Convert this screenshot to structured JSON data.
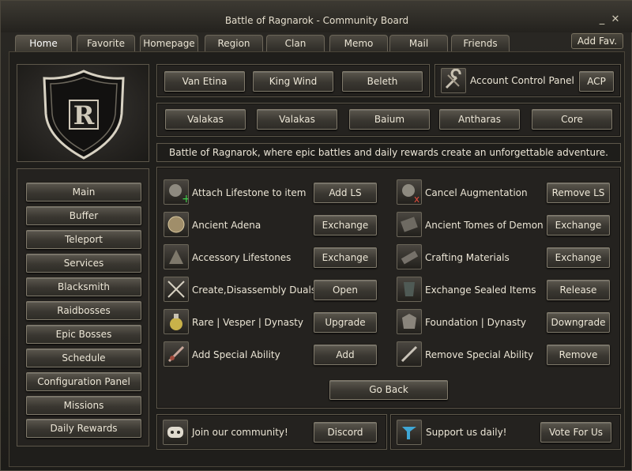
{
  "window": {
    "title": "Battle of Ragnarok - Community Board",
    "minimize": "_",
    "close": "✕"
  },
  "tabs": [
    "Home",
    "Favorite",
    "Homepage",
    "Region",
    "Clan",
    "Memo",
    "Mail",
    "Friends"
  ],
  "add_fav": "Add Fav.",
  "logo": {
    "letter": "R"
  },
  "top_buttons": [
    "Van Etina",
    "King Wind",
    "Beleth"
  ],
  "account": {
    "label": "Account Control Panel",
    "button": "ACP",
    "icon": "wrench-icon"
  },
  "boss_buttons": [
    "Valakas",
    "Valakas",
    "Baium",
    "Antharas",
    "Core"
  ],
  "announcement": "Battle of Ragnarok, where epic battles and daily rewards create an unforgettable adventure.",
  "sidebar": [
    "Main",
    "Buffer",
    "Teleport",
    "Services",
    "Blacksmith",
    "Raidbosses",
    "Epic Bosses",
    "Schedule",
    "Configuration Panel",
    "Missions",
    "Daily Rewards"
  ],
  "services_left": [
    {
      "label": "Attach Lifestone to item",
      "button": "Add LS",
      "icon": "lifestone-add-icon"
    },
    {
      "label": "Ancient Adena",
      "button": "Exchange",
      "icon": "coin-icon"
    },
    {
      "label": "Accessory Lifestones",
      "button": "Exchange",
      "icon": "accessory-icon"
    },
    {
      "label": "Create,Disassembly Duals",
      "button": "Open",
      "icon": "dual-swords-icon"
    },
    {
      "label": "Rare | Vesper | Dynasty",
      "button": "Upgrade",
      "icon": "potion-icon"
    },
    {
      "label": "Add Special Ability",
      "button": "Add",
      "icon": "weapon-sa-icon"
    }
  ],
  "services_right": [
    {
      "label": "Cancel Augmentation",
      "button": "Remove LS",
      "icon": "lifestone-remove-icon"
    },
    {
      "label": "Ancient Tomes of Demon",
      "button": "Exchange",
      "icon": "tome-icon"
    },
    {
      "label": "Crafting Materials",
      "button": "Exchange",
      "icon": "materials-icon"
    },
    {
      "label": "Exchange Sealed Items",
      "button": "Release",
      "icon": "sealed-armor-icon"
    },
    {
      "label": "Foundation | Dynasty",
      "button": "Downgrade",
      "icon": "armor-icon"
    },
    {
      "label": "Remove Special Ability",
      "button": "Remove",
      "icon": "weapon-remove-icon"
    }
  ],
  "go_back": "Go Back",
  "community": {
    "label": "Join our community!",
    "button": "Discord",
    "icon": "discord-icon"
  },
  "support": {
    "label": "Support us daily!",
    "button": "Vote For Us",
    "icon": "vote-icon"
  }
}
